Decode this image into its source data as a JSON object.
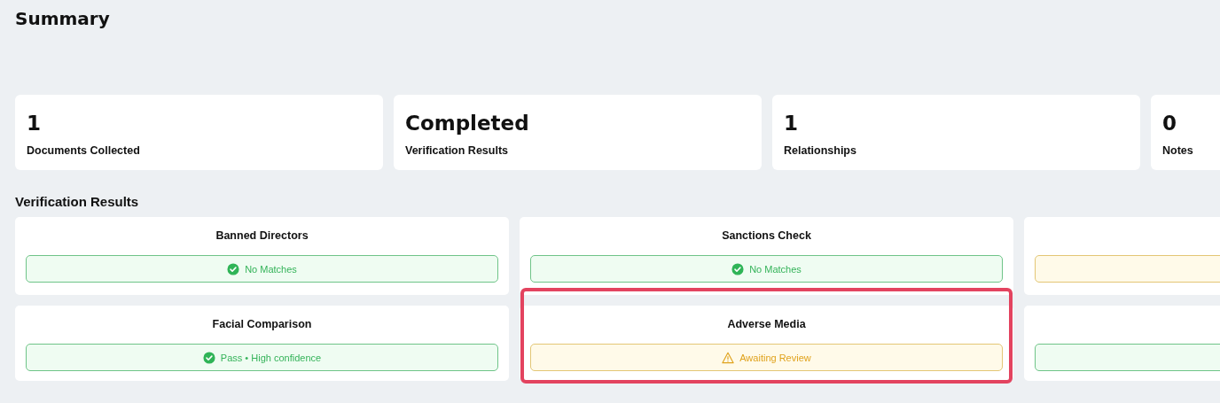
{
  "page_title": "Summary",
  "stats": [
    {
      "value": "1",
      "label": "Documents Collected"
    },
    {
      "value": "Completed",
      "label": "Verification Results"
    },
    {
      "value": "1",
      "label": "Relationships"
    },
    {
      "value": "0",
      "label": "Notes"
    }
  ],
  "verification": {
    "heading": "Verification Results",
    "checks": [
      {
        "title": "Banned Directors",
        "kind": "pass",
        "result": "No Matches",
        "highlighted": false
      },
      {
        "title": "Sanctions Check",
        "kind": "pass",
        "result": "No Matches",
        "highlighted": false
      },
      {
        "kind": "review",
        "highlighted": false
      },
      {
        "title": "Facial Comparison",
        "kind": "pass",
        "result": "Pass • High confidence",
        "highlighted": false
      },
      {
        "title": "Adverse Media",
        "kind": "review",
        "result": "Awaiting Review",
        "highlighted": true
      },
      {
        "kind": "pass",
        "highlighted": false
      }
    ]
  }
}
